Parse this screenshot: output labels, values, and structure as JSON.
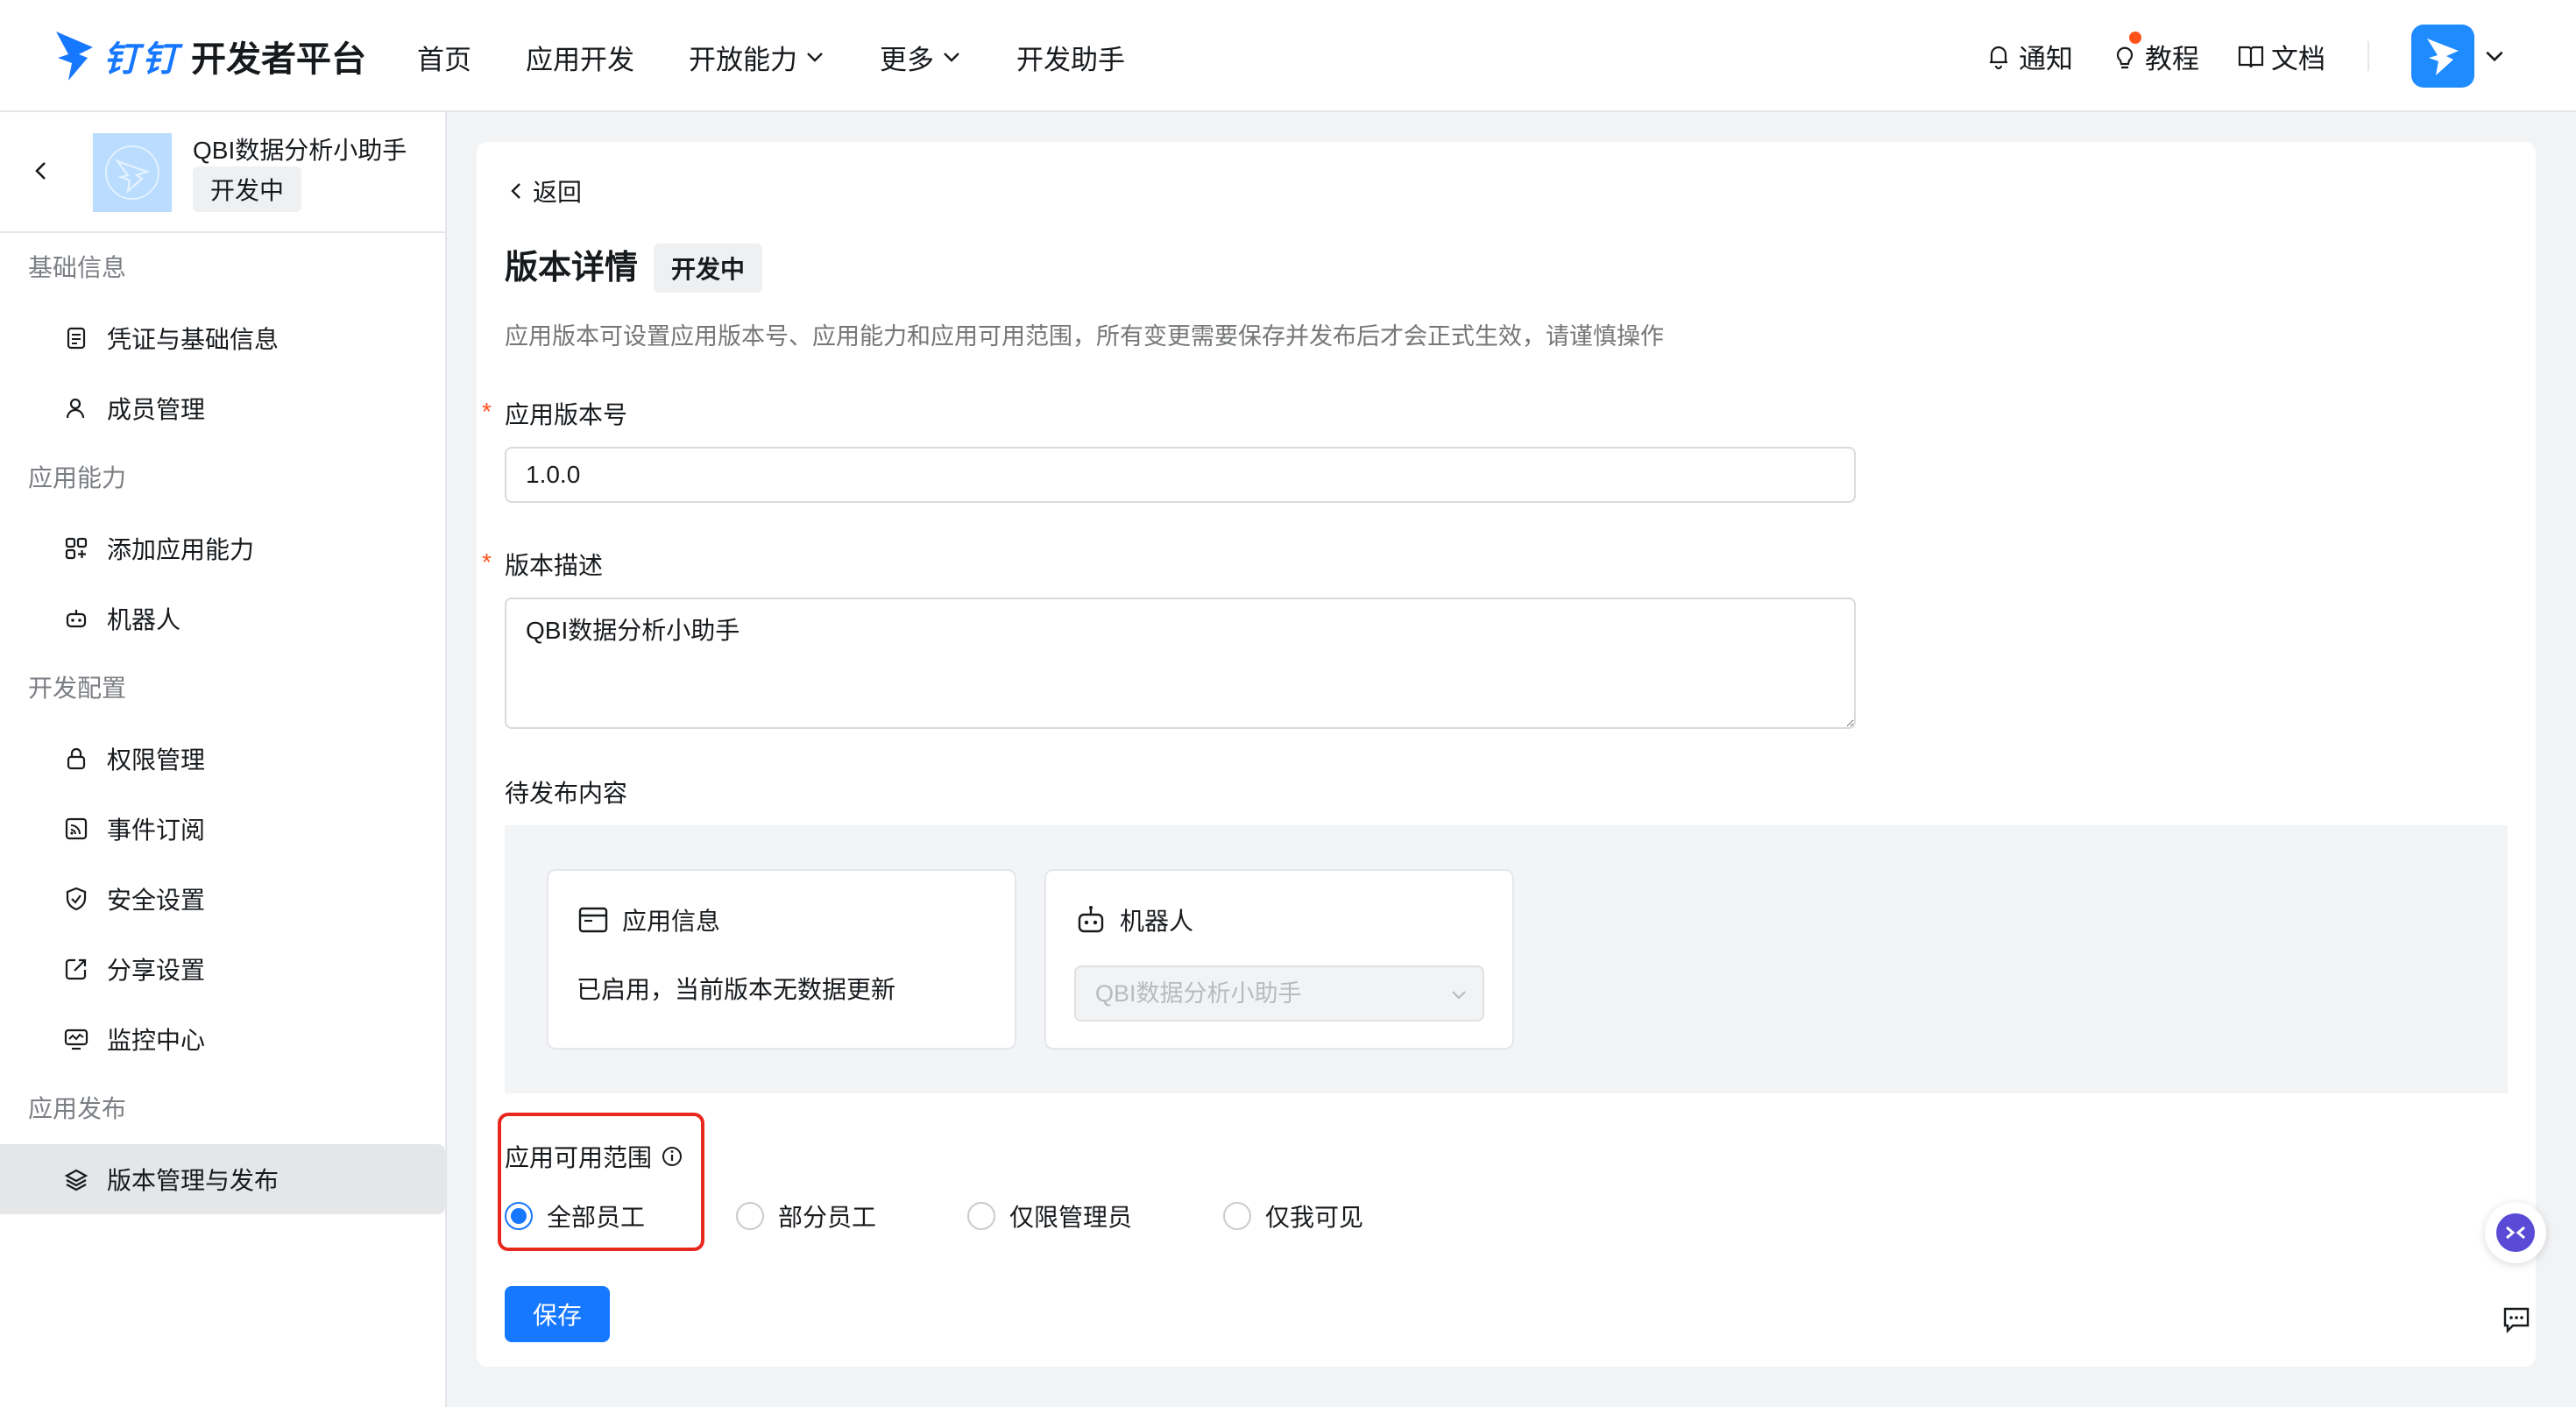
{
  "brand": {
    "name": "钉钉",
    "sub": "开发者平台"
  },
  "nav": [
    {
      "label": "首页"
    },
    {
      "label": "应用开发"
    },
    {
      "label": "开放能力"
    },
    {
      "label": "更多"
    },
    {
      "label": "开发助手"
    }
  ],
  "toolbar": {
    "notify": "通知",
    "tutorial": "教程",
    "docs": "文档"
  },
  "sidebar": {
    "app_name": "QBI数据分析小助手",
    "app_status": "开发中",
    "groups": [
      {
        "title": "基础信息",
        "items": [
          "凭证与基础信息",
          "成员管理"
        ]
      },
      {
        "title": "应用能力",
        "items": [
          "添加应用能力",
          "机器人"
        ]
      },
      {
        "title": "开发配置",
        "items": [
          "权限管理",
          "事件订阅",
          "安全设置",
          "分享设置",
          "监控中心"
        ]
      },
      {
        "title": "应用发布",
        "items": [
          "版本管理与发布"
        ]
      }
    ]
  },
  "main": {
    "back": "返回",
    "title": "版本详情",
    "status": "开发中",
    "description": "应用版本可设置应用版本号、应用能力和应用可用范围，所有变更需要保存并发布后才会正式生效，请谨慎操作",
    "version_label": "应用版本号",
    "version_value": "1.0.0",
    "desc_label": "版本描述",
    "desc_value": "QBI数据分析小助手",
    "pending_label": "待发布内容",
    "app_info": {
      "title": "应用信息",
      "text": "已启用，当前版本无数据更新"
    },
    "robot": {
      "title": "机器人",
      "selected": "QBI数据分析小助手"
    },
    "scope_label": "应用可用范围",
    "scope_options": [
      "全部员工",
      "部分员工",
      "仅限管理员",
      "仅我可见"
    ],
    "scope_selected": "全部员工",
    "save": "保存"
  },
  "colors": {
    "primary": "#1677ff",
    "highlight": "#e8281f",
    "required": "#ff5219"
  }
}
